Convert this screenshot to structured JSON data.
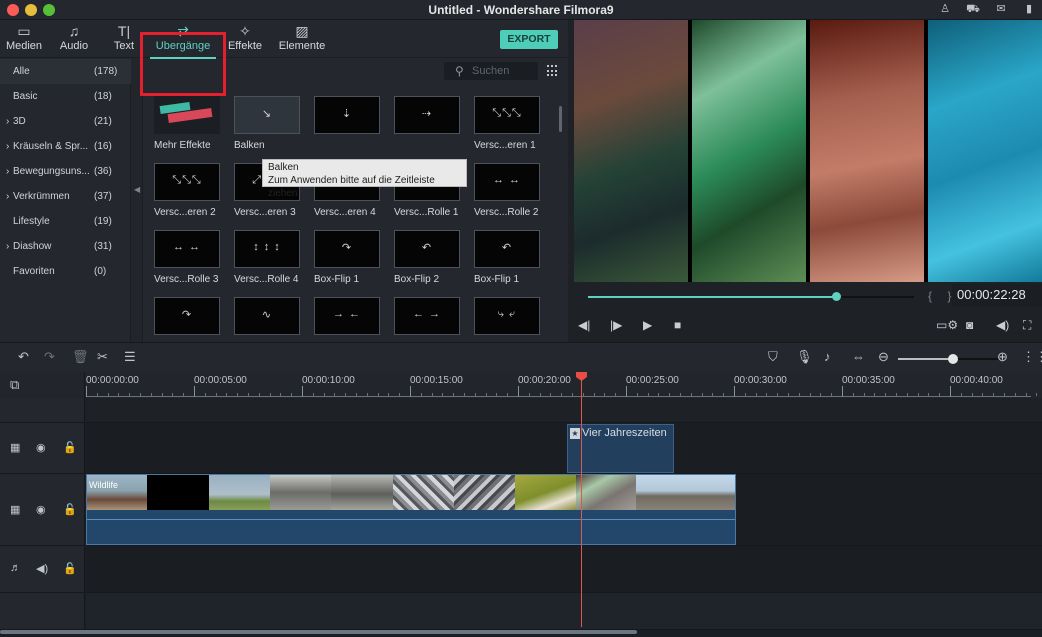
{
  "window": {
    "title": "Untitled - Wondershare Filmora9"
  },
  "titlebar_icons": [
    "user-icon",
    "cart-icon",
    "mail-icon",
    "microphone-icon"
  ],
  "tabs": [
    {
      "label": "Medien",
      "icon": "folder-icon"
    },
    {
      "label": "Audio",
      "icon": "music-note-icon"
    },
    {
      "label": "Text",
      "icon": "text-icon"
    },
    {
      "label": "Ubergänge",
      "icon": "transition-icon",
      "active": true
    },
    {
      "label": "Effekte",
      "icon": "effects-icon"
    },
    {
      "label": "Elemente",
      "icon": "image-icon"
    }
  ],
  "export_label": "EXPORT",
  "search": {
    "placeholder": "Suchen"
  },
  "categories": [
    {
      "name": "Alle",
      "count": "(178)",
      "expandable": false,
      "selected": true
    },
    {
      "name": "Basic",
      "count": "(18)",
      "expandable": false
    },
    {
      "name": "3D",
      "count": "(21)",
      "expandable": true
    },
    {
      "name": "Kräuseln & Spr...",
      "count": "(16)",
      "expandable": true
    },
    {
      "name": "Bewegungsuns...",
      "count": "(36)",
      "expandable": true
    },
    {
      "name": "Verkrümmen",
      "count": "(37)",
      "expandable": true
    },
    {
      "name": "Lifestyle",
      "count": "(19)",
      "expandable": false
    },
    {
      "name": "Diashow",
      "count": "(31)",
      "expandable": true
    },
    {
      "name": "Favoriten",
      "count": "(0)",
      "expandable": false
    }
  ],
  "transitions": [
    {
      "label": "Mehr Effekte",
      "glyph": ""
    },
    {
      "label": "Balken",
      "glyph": "↘"
    },
    {
      "label": "",
      "glyph": "⇣"
    },
    {
      "label": "",
      "glyph": "⇢"
    },
    {
      "label": "Versc...eren 1",
      "glyph": "⤡⤡⤡"
    },
    {
      "label": "Versc...eren 2",
      "glyph": "⤡⤡⤡"
    },
    {
      "label": "Versc...eren 3",
      "glyph": "⤢⤡⤢"
    },
    {
      "label": "Versc...eren 4",
      "glyph": "⤢⤢⤢"
    },
    {
      "label": "Versc...Rolle 1",
      "glyph": "↕ ↕ ↕"
    },
    {
      "label": "Versc...Rolle 2",
      "glyph": "↔ ↔"
    },
    {
      "label": "Versc...Rolle 3",
      "glyph": "↔ ↔"
    },
    {
      "label": "Versc...Rolle 4",
      "glyph": "↕ ↕ ↕"
    },
    {
      "label": "Box-Flip 1",
      "glyph": "↷"
    },
    {
      "label": "Box-Flip 2",
      "glyph": "↶"
    },
    {
      "label": "Box-Flip 1",
      "glyph": "↶"
    },
    {
      "label": "",
      "glyph": "↷"
    },
    {
      "label": "",
      "glyph": "∿"
    },
    {
      "label": "",
      "glyph": "→ ←"
    },
    {
      "label": "",
      "glyph": "← →"
    },
    {
      "label": "",
      "glyph": "⤷ ⤶"
    }
  ],
  "tooltip": {
    "title": "Balken",
    "text": "Zum Anwenden bitte auf die Zeitleiste ziehen"
  },
  "preview": {
    "timecode": "00:00:22:28",
    "progress": 0.76,
    "braces": "{ }"
  },
  "player_controls": [
    "previous-frame",
    "play-frame",
    "play",
    "stop"
  ],
  "player_right_controls": [
    "display-settings",
    "snapshot",
    "volume",
    "fullscreen"
  ],
  "timeline": {
    "zoom_level": 0.55,
    "ruler_labels": [
      "00:00:00:00",
      "00:00:05:00",
      "00:00:10:00",
      "00:00:15:00",
      "00:00:20:00",
      "00:00:25:00",
      "00:00:30:00",
      "00:00:35:00",
      "00:00:40:00"
    ],
    "playhead_time": "00:00:22:28",
    "title_clip": {
      "label": "Vier Jahreszeiten"
    },
    "video_clip": {
      "label": "Wildlife"
    }
  }
}
